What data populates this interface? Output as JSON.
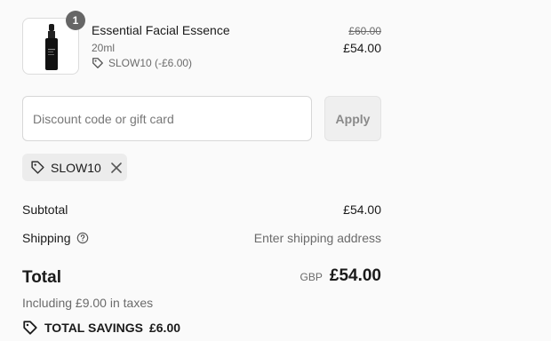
{
  "product": {
    "name": "Essential Facial Essence",
    "variant": "20ml",
    "quantity": "1",
    "discount_code": "SLOW10 (-£6.00)",
    "original_price": "£60.00",
    "price": "£54.00",
    "image_icon": "dropper-bottle-icon"
  },
  "discount": {
    "placeholder": "Discount code or gift card",
    "value": "",
    "apply_label": "Apply",
    "applied_code": "SLOW10"
  },
  "summary": {
    "subtotal_label": "Subtotal",
    "subtotal_value": "£54.00",
    "shipping_label": "Shipping",
    "shipping_value": "Enter shipping address",
    "total_label": "Total",
    "currency": "GBP",
    "total_value": "£54.00",
    "taxes_note": "Including £9.00 in taxes",
    "savings_label": "TOTAL SAVINGS",
    "savings_value": "£6.00"
  },
  "colors": {
    "text": "#1a1a1a",
    "muted": "#6b6b6b",
    "badge": "#666666",
    "chip_bg": "#ececec"
  }
}
